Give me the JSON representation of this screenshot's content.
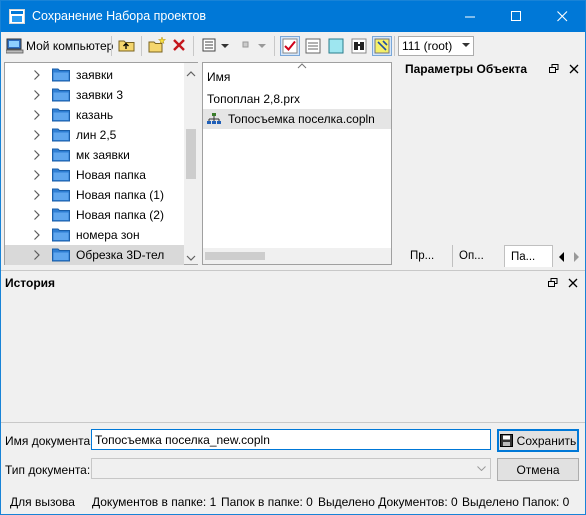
{
  "window": {
    "title": "Сохранение Набора проектов"
  },
  "toolbar": {
    "my_computer": "Мой компьютер",
    "user_combo": "111 (root)"
  },
  "tree": {
    "items": [
      {
        "label": "заявки"
      },
      {
        "label": "заявки 3"
      },
      {
        "label": "казань"
      },
      {
        "label": "лин 2,5"
      },
      {
        "label": "мк заявки"
      },
      {
        "label": "Новая папка"
      },
      {
        "label": "Новая папка (1)"
      },
      {
        "label": "Новая папка (2)"
      },
      {
        "label": "номера зон"
      },
      {
        "label": "Обрезка 3D-тел"
      }
    ]
  },
  "files": {
    "column_name": "Имя",
    "rows": [
      {
        "name": "Топоплан 2,8.prx"
      },
      {
        "name": "Топосъемка поселка.copln"
      }
    ]
  },
  "props": {
    "title": "Параметры Объекта",
    "tabs": [
      "Пр...",
      "Оп...",
      "Па..."
    ]
  },
  "history": {
    "title": "История"
  },
  "form": {
    "doc_name_label": "Имя документа:",
    "doc_name_value": "Топосъемка поселка_new.copln",
    "doc_type_label": "Тип документа:",
    "doc_type_value": "",
    "save_label": "Сохранить",
    "cancel_label": "Отмена"
  },
  "status": {
    "call_for": "Для вызова",
    "docs_in_folder": "Документов в папке: 1",
    "folders_in_folder": "Папок в папке: 0",
    "selected_docs": "Выделено Документов: 0",
    "selected_folders": "Выделено Папок: 0"
  },
  "colors": {
    "titlebar": "#0078d7",
    "folder": "#3d87d9",
    "check_red": "#d0021b"
  }
}
